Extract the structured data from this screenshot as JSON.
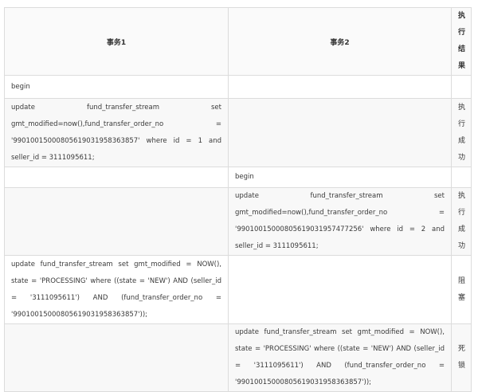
{
  "table": {
    "headers": {
      "tx1": "事务1",
      "tx2": "事务2",
      "result": "执行结果"
    },
    "rows": [
      {
        "tx1": "begin",
        "tx2": "",
        "result": ""
      },
      {
        "tx1_lines": [
          "update fund_transfer_stream set gmt_modified=now(),fund_transfer_order_no = '99010015000805619031958363857' where id = 1 and",
          "seller_id = 3111095611;"
        ],
        "tx2": "",
        "result": "执行成功"
      },
      {
        "tx1": "",
        "tx2": "begin",
        "result": ""
      },
      {
        "tx1": "",
        "tx2_lines": [
          "update fund_transfer_stream set gmt_modified=now(),fund_transfer_order_no = '99010015000805619031957477256' where id = 2 and",
          "seller_id = 3111095611;"
        ],
        "result": "执行成功"
      },
      {
        "tx1_lines": [
          "update fund_transfer_stream set gmt_modified = NOW(), state = 'PROCESSING' where ((state = 'NEW') AND (seller_id = '3111095611') AND (fund_transfer_order_no =",
          "'99010015000805619031958363857'));"
        ],
        "tx2": "",
        "result": "阻塞"
      },
      {
        "tx1": "",
        "tx2_lines": [
          "update fund_transfer_stream set gmt_modified = NOW(), state = 'PROCESSING' where ((state = 'NEW') AND (seller_id = '3111095611') AND (fund_transfer_order_no =",
          "'99010015000805619031958363857'));"
        ],
        "result": "死锁"
      }
    ]
  }
}
